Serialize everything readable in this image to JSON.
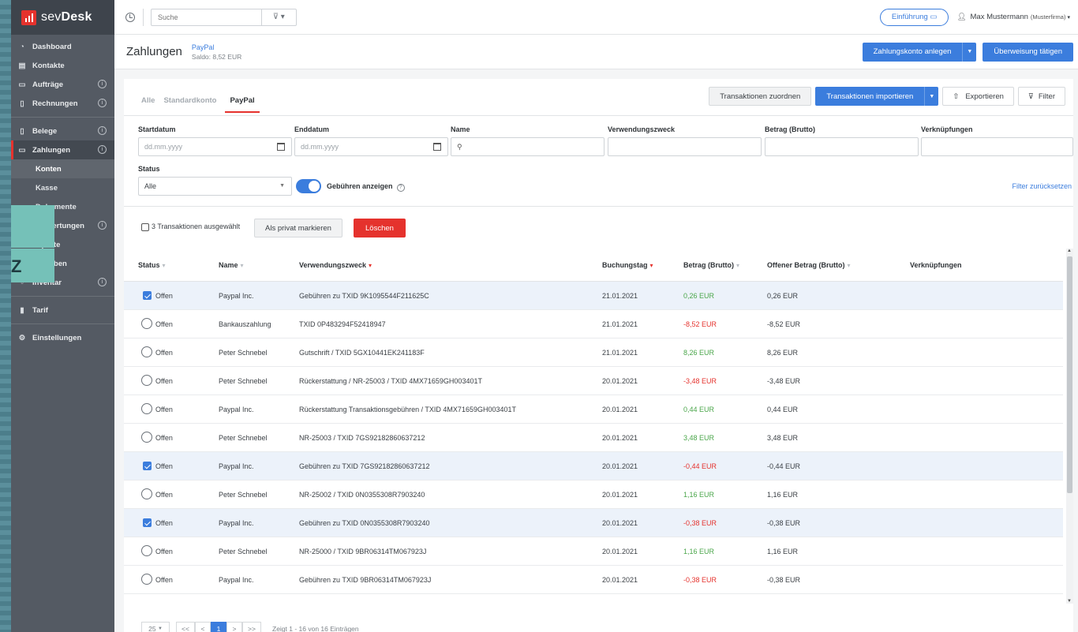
{
  "brand": {
    "name_plain": "sev",
    "name_bold": "Desk"
  },
  "sidebar": {
    "items": [
      {
        "label": "Dashboard",
        "icon": "dashboard-icon",
        "info": false
      },
      {
        "label": "Kontakte",
        "icon": "contacts-icon",
        "info": false
      },
      {
        "label": "Aufträge",
        "icon": "folder-icon",
        "info": true
      },
      {
        "label": "Rechnungen",
        "icon": "document-icon",
        "info": true
      }
    ],
    "items2": [
      {
        "label": "Belege",
        "icon": "receipt-icon",
        "info": true
      },
      {
        "label": "Zahlungen",
        "icon": "card-icon",
        "info": true
      }
    ],
    "sub": [
      "Konten",
      "Kasse",
      "Dokumente"
    ],
    "items3": [
      {
        "label": "Auswertungen",
        "info": true
      },
      {
        "label": "Exporte",
        "info": false
      },
      {
        "label": "Aufgaben",
        "info": false
      },
      {
        "label": "Inventar",
        "info": true
      }
    ],
    "tarif": "Tarif",
    "settings": "Einstellungen",
    "overlay_char": "Z"
  },
  "topbar": {
    "search_placeholder": "Suche",
    "intro_label": "Einführung",
    "user_name": "Max Mustermann",
    "user_company": "(Musterfirma)"
  },
  "header": {
    "title": "Zahlungen",
    "account_name": "PayPal",
    "saldo": "Saldo: 8,52 EUR",
    "btn_create_account": "Zahlungskonto anlegen",
    "btn_transfer": "Überweisung tätigen"
  },
  "tabs": [
    "Alle",
    "Standardkonto",
    "PayPal"
  ],
  "actions": {
    "assign": "Transaktionen zuordnen",
    "import": "Transaktionen importieren",
    "export": "Exportieren",
    "filter": "Filter"
  },
  "filters": {
    "start_label": "Startdatum",
    "start_placeholder": "dd.mm.yyyy",
    "end_label": "Enddatum",
    "end_placeholder": "dd.mm.yyyy",
    "name_label": "Name",
    "purpose_label": "Verwendungszweck",
    "amount_label": "Betrag (Brutto)",
    "links_label": "Verknüpfungen",
    "status_label": "Status",
    "status_value": "Alle",
    "fees_label": "Gebühren anzeigen",
    "reset": "Filter zurücksetzen"
  },
  "bulk": {
    "selected": "3 Transaktionen ausgewählt",
    "mark_private": "Als privat markieren",
    "delete": "Löschen"
  },
  "table": {
    "headers": [
      "Status",
      "Name",
      "Verwendungszweck",
      "Buchungstag",
      "Betrag (Brutto)",
      "Offener Betrag (Brutto)",
      "Verknüpfungen"
    ],
    "rows": [
      {
        "sel": true,
        "status": "Offen",
        "name": "Paypal Inc.",
        "purpose": "Gebühren zu TXID 9K1095544F211625C",
        "date": "21.01.2021",
        "amount": "0,26 EUR",
        "sign": "pos",
        "open": "0,26 EUR"
      },
      {
        "sel": false,
        "status": "Offen",
        "name": "Bankauszahlung",
        "purpose": "TXID 0P483294F52418947",
        "date": "21.01.2021",
        "amount": "-8,52 EUR",
        "sign": "neg",
        "open": "-8,52 EUR"
      },
      {
        "sel": false,
        "status": "Offen",
        "name": "Peter Schnebel",
        "purpose": "Gutschrift / TXID 5GX10441EK241183F",
        "date": "21.01.2021",
        "amount": "8,26 EUR",
        "sign": "pos",
        "open": "8,26 EUR"
      },
      {
        "sel": false,
        "status": "Offen",
        "name": "Peter Schnebel",
        "purpose": "Rückerstattung / NR-25003 / TXID 4MX71659GH003401T",
        "date": "20.01.2021",
        "amount": "-3,48 EUR",
        "sign": "neg",
        "open": "-3,48 EUR"
      },
      {
        "sel": false,
        "status": "Offen",
        "name": "Paypal Inc.",
        "purpose": "Rückerstattung Transaktionsgebühren / TXID 4MX71659GH003401T",
        "date": "20.01.2021",
        "amount": "0,44 EUR",
        "sign": "pos",
        "open": "0,44 EUR"
      },
      {
        "sel": false,
        "status": "Offen",
        "name": "Peter Schnebel",
        "purpose": "NR-25003 / TXID 7GS92182860637212",
        "date": "20.01.2021",
        "amount": "3,48 EUR",
        "sign": "pos",
        "open": "3,48 EUR"
      },
      {
        "sel": true,
        "status": "Offen",
        "name": "Paypal Inc.",
        "purpose": "Gebühren zu TXID 7GS92182860637212",
        "date": "20.01.2021",
        "amount": "-0,44 EUR",
        "sign": "neg",
        "open": "-0,44 EUR"
      },
      {
        "sel": false,
        "status": "Offen",
        "name": "Peter Schnebel",
        "purpose": "NR-25002 / TXID 0N0355308R7903240",
        "date": "20.01.2021",
        "amount": "1,16 EUR",
        "sign": "pos",
        "open": "1,16 EUR"
      },
      {
        "sel": true,
        "status": "Offen",
        "name": "Paypal Inc.",
        "purpose": "Gebühren zu TXID 0N0355308R7903240",
        "date": "20.01.2021",
        "amount": "-0,38 EUR",
        "sign": "neg",
        "open": "-0,38 EUR"
      },
      {
        "sel": false,
        "status": "Offen",
        "name": "Peter Schnebel",
        "purpose": "NR-25000 / TXID 9BR06314TM067923J",
        "date": "20.01.2021",
        "amount": "1,16 EUR",
        "sign": "pos",
        "open": "1,16 EUR"
      },
      {
        "sel": false,
        "status": "Offen",
        "name": "Paypal Inc.",
        "purpose": "Gebühren zu TXID 9BR06314TM067923J",
        "date": "20.01.2021",
        "amount": "-0,38 EUR",
        "sign": "neg",
        "open": "-0,38 EUR"
      }
    ]
  },
  "pagination": {
    "per_page": "25",
    "first": "<<",
    "prev": "<",
    "current": "1",
    "next": ">",
    "last": ">>",
    "summary": "Zeigt 1 - 16 von 16 Einträgen"
  },
  "colors": {
    "accent": "#3b7ddd",
    "brand": "#e5322d",
    "positive": "#4aa64a",
    "negative": "#e5322d"
  }
}
